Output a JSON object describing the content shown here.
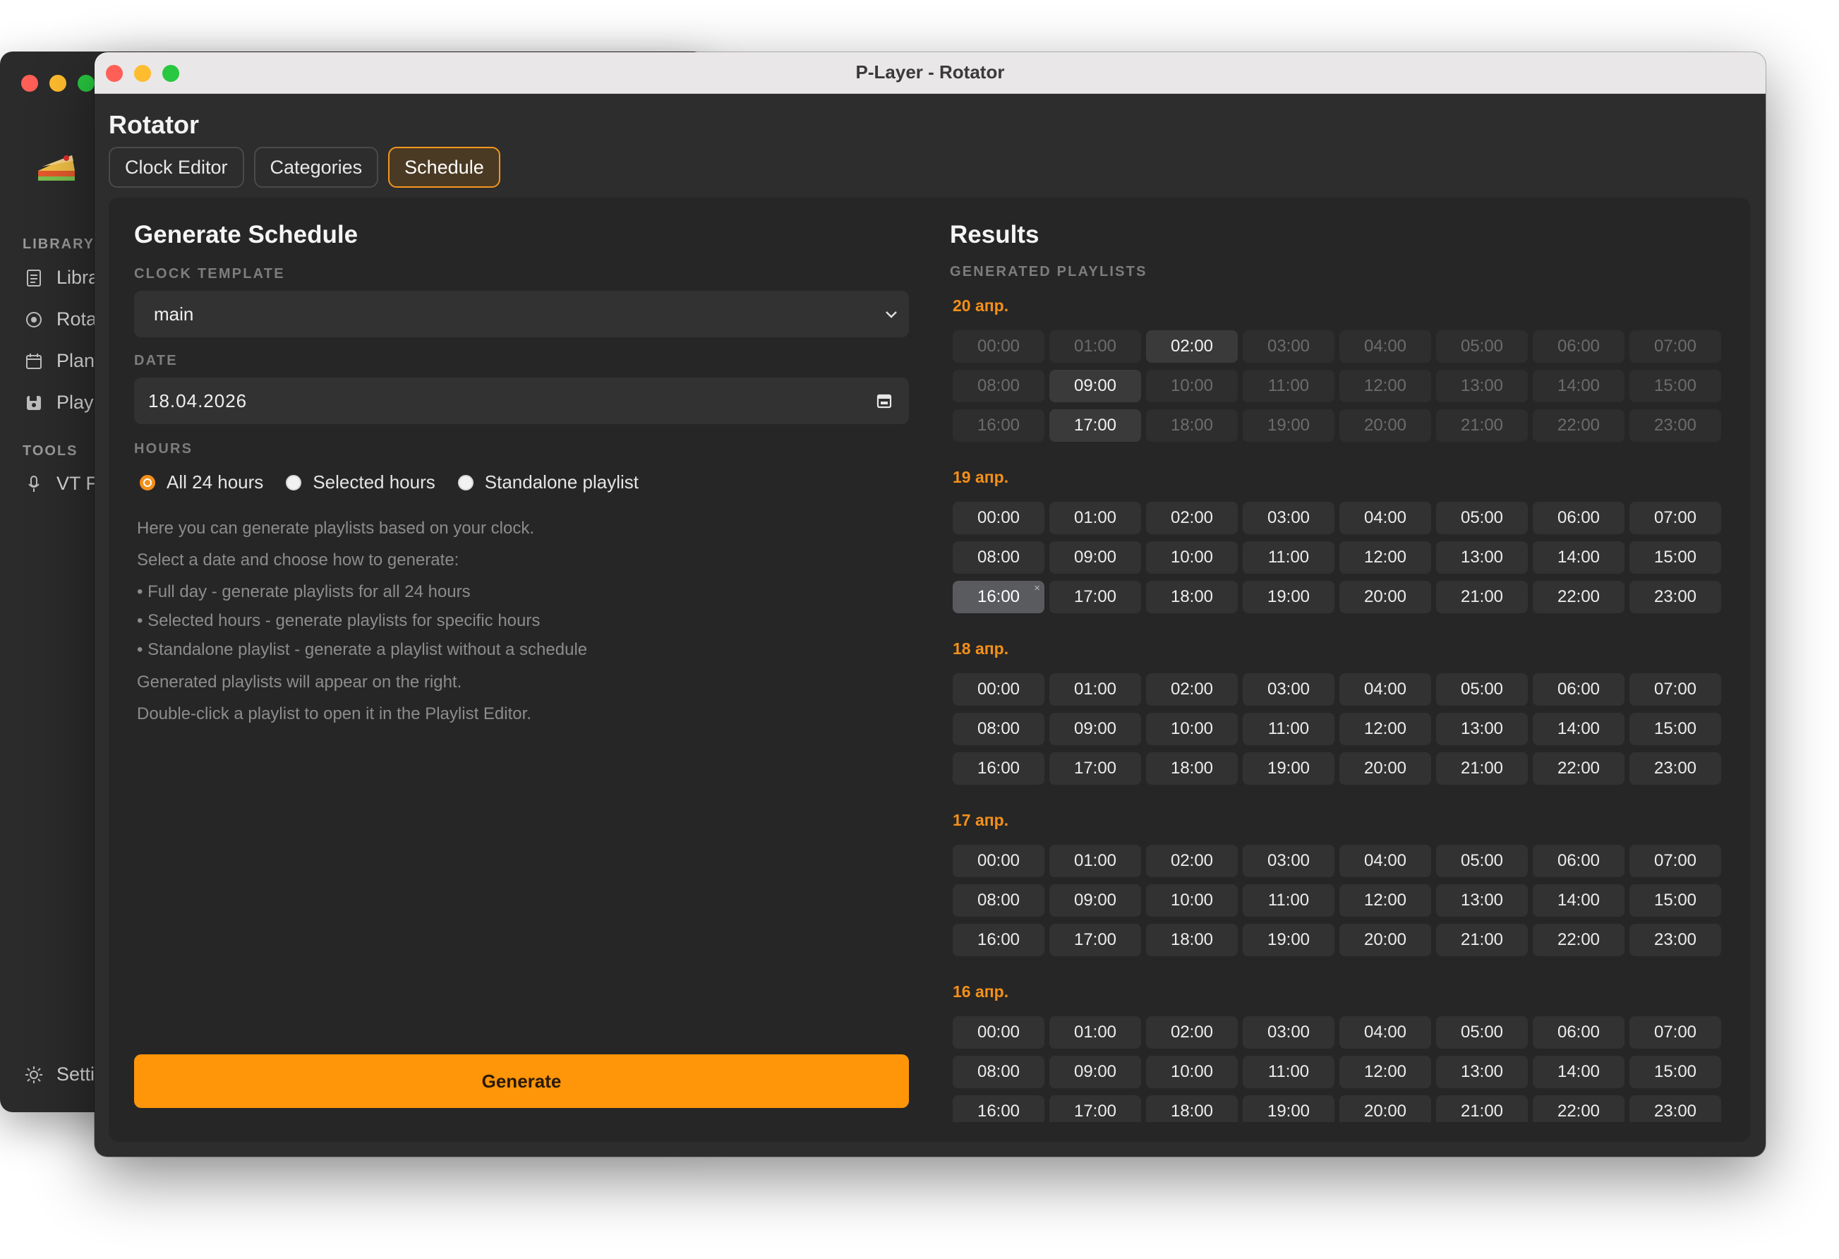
{
  "window": {
    "title": "P-Layer - Rotator"
  },
  "sidebar": {
    "sections": [
      {
        "title": "LIBRARY",
        "items": [
          "Libra",
          "Rota",
          "Plan",
          "Play"
        ]
      },
      {
        "title": "TOOLS",
        "items": [
          "VT F"
        ]
      }
    ],
    "settings_label": "Setti"
  },
  "app": {
    "title": "Rotator"
  },
  "tabs": [
    "Clock Editor",
    "Categories",
    "Schedule"
  ],
  "active_tab": "Schedule",
  "generate": {
    "heading": "Generate Schedule",
    "clock_template_label": "CLOCK TEMPLATE",
    "clock_template_value": "main",
    "date_label": "DATE",
    "date_value": "18.04.2026",
    "hours_label": "HOURS",
    "hours_options": [
      "All 24 hours",
      "Selected hours",
      "Standalone playlist"
    ],
    "hours_selected": "All 24 hours",
    "help_lines": [
      "Here you can generate playlists based on your clock.",
      "Select a date and choose how to generate:",
      "• Full day - generate playlists for all 24 hours",
      "• Selected hours - generate playlists for specific hours",
      "• Standalone playlist - generate a playlist without a schedule",
      "Generated playlists will appear on the right.",
      "Double-click a playlist to open it in the Playlist Editor."
    ],
    "button_label": "Generate"
  },
  "results": {
    "heading": "Results",
    "subheading": "GENERATED PLAYLISTS",
    "days": [
      {
        "label": "20 апр.",
        "available": [
          "02:00",
          "09:00",
          "17:00"
        ],
        "selected": null
      },
      {
        "label": "19 апр.",
        "available": "all",
        "selected": "16:00"
      },
      {
        "label": "18 апр.",
        "available": "all",
        "selected": null
      },
      {
        "label": "17 апр.",
        "available": "all",
        "selected": null
      },
      {
        "label": "16 апр.",
        "available": "all",
        "selected": null
      }
    ],
    "hours": [
      "00:00",
      "01:00",
      "02:00",
      "03:00",
      "04:00",
      "05:00",
      "06:00",
      "07:00",
      "08:00",
      "09:00",
      "10:00",
      "11:00",
      "12:00",
      "13:00",
      "14:00",
      "15:00",
      "16:00",
      "17:00",
      "18:00",
      "19:00",
      "20:00",
      "21:00",
      "22:00",
      "23:00"
    ],
    "remove_glyph": "×"
  }
}
